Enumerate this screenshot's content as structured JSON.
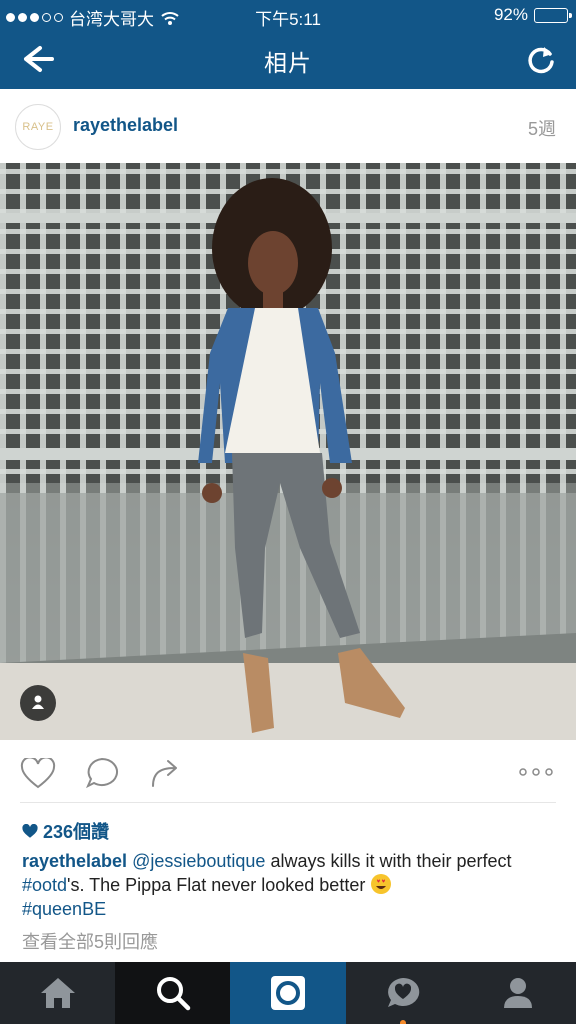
{
  "status_bar": {
    "carrier": "台湾大哥大",
    "time": "下午5:11",
    "battery": "92%",
    "battery_level": 0.92,
    "signal_bars": 3,
    "signal_total": 5
  },
  "nav": {
    "title": "相片",
    "back_icon": "arrow-left-icon",
    "refresh_icon": "refresh-icon"
  },
  "post": {
    "avatar_text": "RAYE",
    "username": "rayethelabel",
    "time_ago": "5週",
    "likes": "236個讚",
    "caption": {
      "user": "rayethelabel",
      "mention": "@jessieboutique",
      "text1": " always kills it with their perfect ",
      "hashtag1": "#ootd",
      "text2": "'s. The Pippa Flat never looked better ",
      "hashtag2": "#queenBE"
    },
    "view_comments": "查看全部5則回應"
  },
  "tabs": [
    {
      "icon": "home-icon"
    },
    {
      "icon": "search-icon"
    },
    {
      "icon": "camera-icon"
    },
    {
      "icon": "activity-icon"
    },
    {
      "icon": "profile-icon"
    }
  ],
  "colors": {
    "brand": "#125688",
    "tabbar": "#23272c",
    "notification_dot": "#f68b2b"
  }
}
